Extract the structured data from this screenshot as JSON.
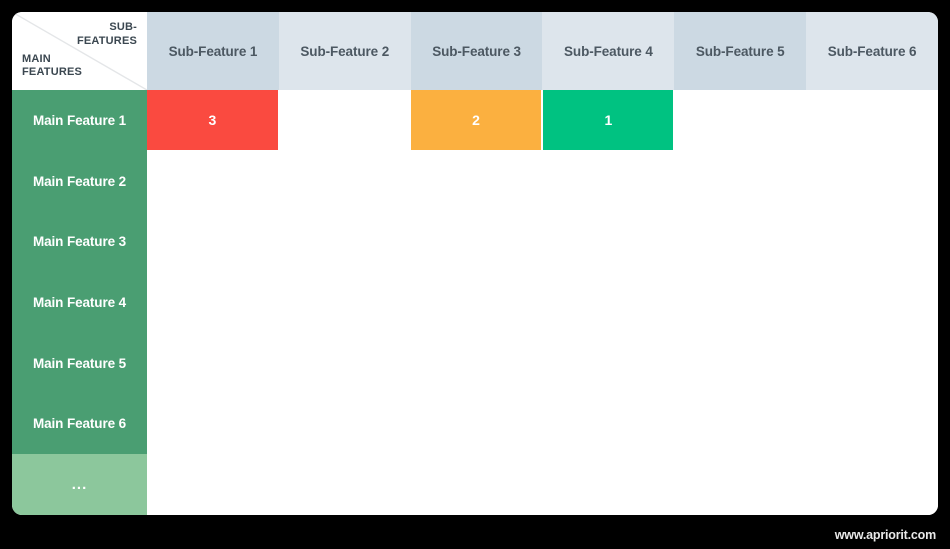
{
  "corner": {
    "sub_label": "SUB-\nFEATURES",
    "sub_label_line1": "SUB-",
    "sub_label_line2": "FEATURES",
    "main_label_line1": "MAIN",
    "main_label_line2": "FEATURES"
  },
  "columns": [
    {
      "label": "Sub-Feature 1",
      "shade": "dark"
    },
    {
      "label": "Sub-Feature 2",
      "shade": "light"
    },
    {
      "label": "Sub-Feature 3",
      "shade": "dark"
    },
    {
      "label": "Sub-Feature 4",
      "shade": "light"
    },
    {
      "label": "Sub-Feature 5",
      "shade": "dark"
    },
    {
      "label": "Sub-Feature 6",
      "shade": "light"
    }
  ],
  "rows": [
    {
      "label": "Main Feature 1",
      "muted": false
    },
    {
      "label": "Main Feature 2",
      "muted": false
    },
    {
      "label": "Main Feature 3",
      "muted": false
    },
    {
      "label": "Main Feature 4",
      "muted": false
    },
    {
      "label": "Main Feature 5",
      "muted": false
    },
    {
      "label": "Main Feature 6",
      "muted": false
    },
    {
      "label": "...",
      "muted": true
    }
  ],
  "cells": [
    [
      {
        "value": "3",
        "color": "#fa4a40"
      },
      {
        "value": "",
        "color": ""
      },
      {
        "value": "2",
        "color": "#fbb council"
      },
      {
        "value": "1",
        "color": "#00c281"
      },
      {
        "value": "",
        "color": ""
      },
      {
        "value": "",
        "color": ""
      }
    ],
    [
      {
        "value": "",
        "color": ""
      },
      {
        "value": "",
        "color": ""
      },
      {
        "value": "",
        "color": ""
      },
      {
        "value": "",
        "color": ""
      },
      {
        "value": "",
        "color": ""
      },
      {
        "value": "",
        "color": ""
      }
    ],
    [
      {
        "value": "",
        "color": ""
      },
      {
        "value": "",
        "color": ""
      },
      {
        "value": "",
        "color": ""
      },
      {
        "value": "",
        "color": ""
      },
      {
        "value": "",
        "color": ""
      },
      {
        "value": "",
        "color": ""
      }
    ],
    [
      {
        "value": "",
        "color": ""
      },
      {
        "value": "",
        "color": ""
      },
      {
        "value": "",
        "color": ""
      },
      {
        "value": "",
        "color": ""
      },
      {
        "value": "",
        "color": ""
      },
      {
        "value": "",
        "color": ""
      }
    ],
    [
      {
        "value": "",
        "color": ""
      },
      {
        "value": "",
        "color": ""
      },
      {
        "value": "",
        "color": ""
      },
      {
        "value": "",
        "color": ""
      },
      {
        "value": "",
        "color": ""
      },
      {
        "value": "",
        "color": ""
      }
    ],
    [
      {
        "value": "",
        "color": ""
      },
      {
        "value": "",
        "color": ""
      },
      {
        "value": "",
        "color": ""
      },
      {
        "value": "",
        "color": ""
      },
      {
        "value": "",
        "color": ""
      },
      {
        "value": "",
        "color": ""
      }
    ],
    [
      {
        "value": "",
        "color": ""
      },
      {
        "value": "",
        "color": ""
      },
      {
        "value": "",
        "color": ""
      },
      {
        "value": "",
        "color": ""
      },
      {
        "value": "",
        "color": ""
      },
      {
        "value": "",
        "color": ""
      }
    ]
  ],
  "watermark": "www.apriorit.com",
  "theme": {
    "header_dark": "#ccd9e3",
    "header_light": "#dde5ec",
    "main_feature_green": "#4a9e72",
    "main_feature_green_muted": "#8cc79c",
    "priority_1": "#00c281",
    "priority_2": "#fbb040",
    "priority_3": "#fa4a40",
    "grid_line": "#f1f2f3",
    "page_background": "#000000",
    "card_background": "#ffffff"
  }
}
